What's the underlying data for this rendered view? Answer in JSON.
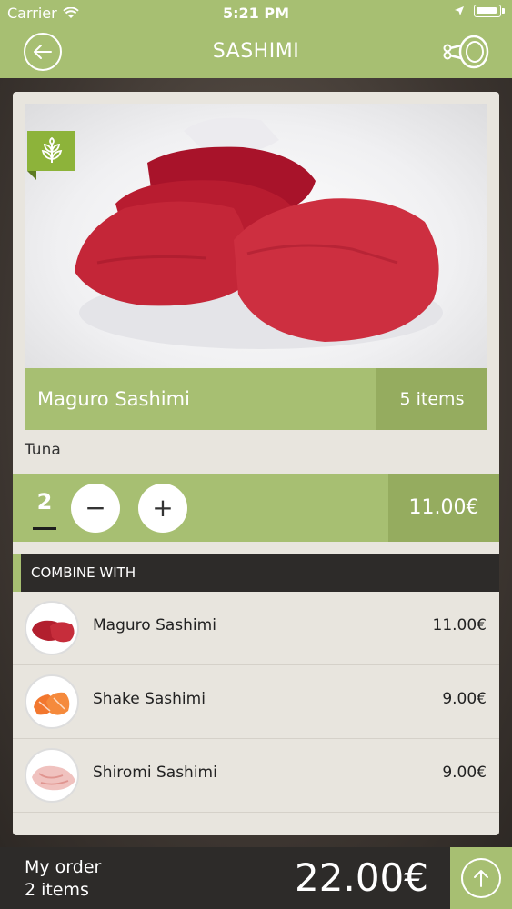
{
  "status": {
    "carrier": "Carrier",
    "time": "5:21 PM"
  },
  "nav": {
    "title": "SASHIMI",
    "back_icon": "back-arrow-icon",
    "category_icon": "ham-leg-icon"
  },
  "product": {
    "name": "Maguro Sashimi",
    "items": "5 items",
    "description": "Tuna",
    "badge_icon": "vegetarian-leaf-icon"
  },
  "quantity": {
    "value": "2",
    "minus": "−",
    "plus": "+",
    "price": "11.00€"
  },
  "combine": {
    "header": "COMBINE WITH",
    "items": [
      {
        "name": "Maguro Sashimi",
        "price": "11.00€",
        "thumb_color": "#b21f2e"
      },
      {
        "name": "Shake Sashimi",
        "price": "9.00€",
        "thumb_color": "#f2772e"
      },
      {
        "name": "Shiromi Sashimi",
        "price": "9.00€",
        "thumb_color": "#f0c2bf"
      }
    ]
  },
  "order": {
    "label": "My order",
    "count": "2 items",
    "total": "22.00€"
  },
  "colors": {
    "accent": "#a7bf72",
    "accent_dark": "#95ac5f",
    "dark": "#2d2b29"
  }
}
